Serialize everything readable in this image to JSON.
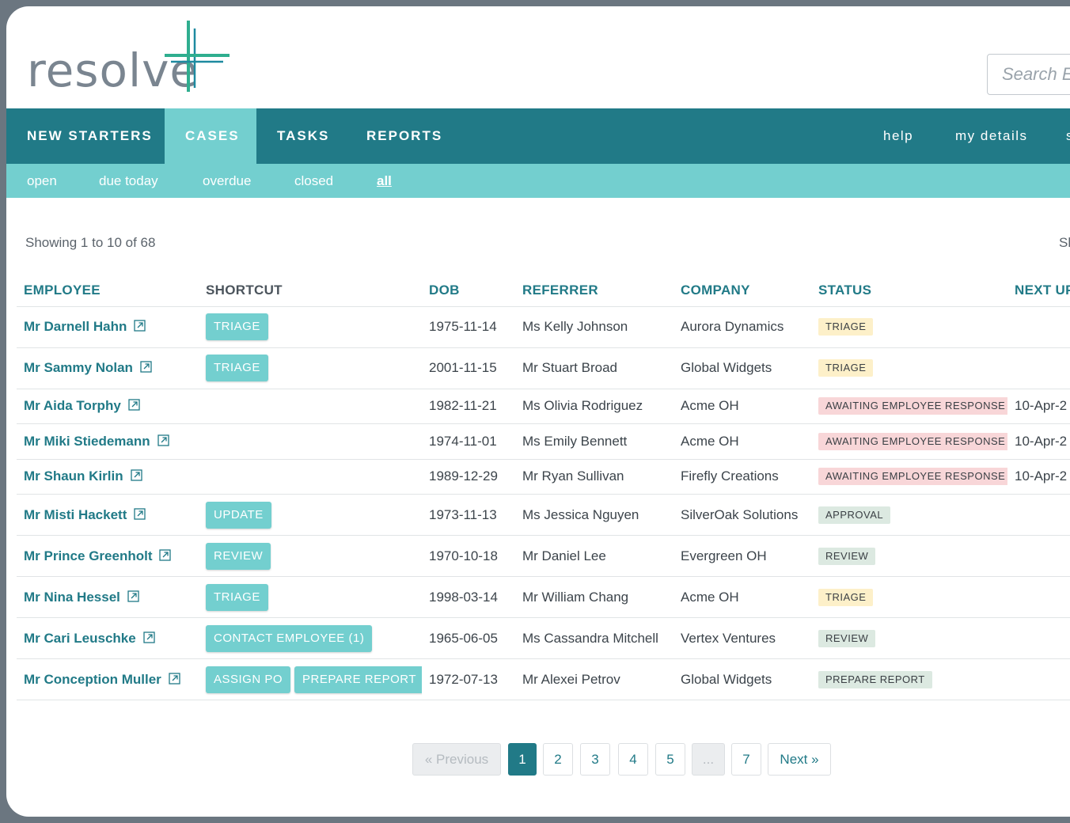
{
  "brand": {
    "name": "resolve"
  },
  "search": {
    "placeholder": "Search Em"
  },
  "nav": {
    "items": [
      "NEW STARTERS",
      "CASES",
      "TASKS",
      "REPORTS"
    ],
    "active": "CASES",
    "right": [
      "help",
      "my details",
      "s"
    ]
  },
  "subnav": {
    "items": [
      "open",
      "due today",
      "overdue",
      "closed",
      "all"
    ],
    "active": "all"
  },
  "showing": "Showing 1 to 10 of 68",
  "show_right": "Sh",
  "table": {
    "columns": [
      "EMPLOYEE",
      "SHORTCUT",
      "DOB",
      "REFERRER",
      "COMPANY",
      "STATUS",
      "NEXT UP"
    ],
    "rows": [
      {
        "employee": "Mr Darnell Hahn",
        "shortcuts": [
          "TRIAGE"
        ],
        "dob": "1975-11-14",
        "referrer": "Ms Kelly Johnson",
        "company": "Aurora Dynamics",
        "status": "TRIAGE",
        "next": ""
      },
      {
        "employee": "Mr Sammy Nolan",
        "shortcuts": [
          "TRIAGE"
        ],
        "dob": "2001-11-15",
        "referrer": "Mr Stuart Broad",
        "company": "Global Widgets",
        "status": "TRIAGE",
        "next": ""
      },
      {
        "employee": "Mr Aida Torphy",
        "shortcuts": [],
        "dob": "1982-11-21",
        "referrer": "Ms Olivia Rodriguez",
        "company": "Acme OH",
        "status": "AWAITING EMPLOYEE RESPONSE",
        "next": "10-Apr-2"
      },
      {
        "employee": "Mr Miki Stiedemann",
        "shortcuts": [],
        "dob": "1974-11-01",
        "referrer": "Ms Emily Bennett",
        "company": "Acme OH",
        "status": "AWAITING EMPLOYEE RESPONSE",
        "next": "10-Apr-2"
      },
      {
        "employee": "Mr Shaun Kirlin",
        "shortcuts": [],
        "dob": "1989-12-29",
        "referrer": "Mr Ryan Sullivan",
        "company": "Firefly Creations",
        "status": "AWAITING EMPLOYEE RESPONSE",
        "next": "10-Apr-2"
      },
      {
        "employee": "Mr Misti Hackett",
        "shortcuts": [
          "UPDATE"
        ],
        "dob": "1973-11-13",
        "referrer": "Ms Jessica Nguyen",
        "company": "SilverOak Solutions",
        "status": "APPROVAL",
        "next": ""
      },
      {
        "employee": "Mr Prince Greenholt",
        "shortcuts": [
          "REVIEW"
        ],
        "dob": "1970-10-18",
        "referrer": "Mr Daniel Lee",
        "company": "Evergreen OH",
        "status": "REVIEW",
        "next": ""
      },
      {
        "employee": "Mr Nina Hessel",
        "shortcuts": [
          "TRIAGE"
        ],
        "dob": "1998-03-14",
        "referrer": "Mr William Chang",
        "company": "Acme OH",
        "status": "TRIAGE",
        "next": ""
      },
      {
        "employee": "Mr Cari Leuschke",
        "shortcuts": [
          "CONTACT EMPLOYEE (1)"
        ],
        "dob": "1965-06-05",
        "referrer": "Ms Cassandra Mitchell",
        "company": "Vertex Ventures",
        "status": "REVIEW",
        "next": ""
      },
      {
        "employee": "Mr Conception Muller",
        "shortcuts": [
          "ASSIGN PO",
          "PREPARE REPORT"
        ],
        "dob": "1972-07-13",
        "referrer": "Mr Alexei Petrov",
        "company": "Global Widgets",
        "status": "PREPARE REPORT",
        "next": ""
      }
    ]
  },
  "pagination": {
    "previous": "« Previous",
    "pages": [
      "1",
      "2",
      "3",
      "4",
      "5",
      "...",
      "7"
    ],
    "current": "1",
    "next": "Next »"
  },
  "colors": {
    "nav_bg": "#217a87",
    "accent_light": "#73cfcf",
    "badge_triage": "#fdf0c9",
    "badge_awaiting": "#f8d6d8",
    "badge_green": "#dce9e1"
  }
}
